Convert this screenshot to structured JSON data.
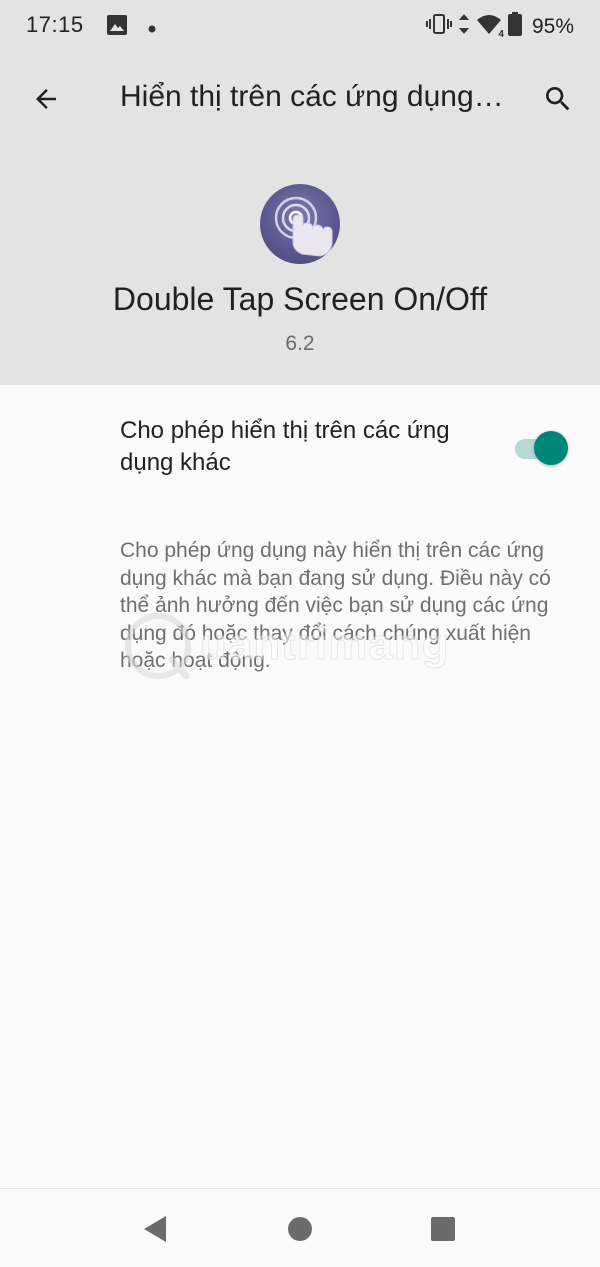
{
  "status_bar": {
    "time": "17:15",
    "left_icons": [
      "image-icon",
      "dot-icon"
    ],
    "right_icons": [
      "vibrate-icon",
      "data-arrows-icon",
      "wifi-icon",
      "battery-icon"
    ],
    "network_badge": "4",
    "battery_percent": "95%"
  },
  "toolbar": {
    "title": "Hiển thị trên các ứng dụng khác",
    "back_icon": "arrow-back-icon",
    "search_icon": "search-icon"
  },
  "app": {
    "name": "Double Tap Screen On/Off",
    "version": "6.2",
    "icon": "double-tap-finger-icon"
  },
  "permission": {
    "label": "Cho phép hiển thị trên các ứng dụng khác",
    "enabled": true
  },
  "description": "Cho phép ứng dụng này hiển thị trên các ứng dụng khác mà bạn đang sử dụng. Điều này có thể ảnh hưởng đến việc bạn sử dụng các ứng dụng đó hoặc thay đổi cách chúng xuất hiện hoặc hoạt động.",
  "watermark": {
    "text": "uantrimang"
  },
  "nav_bar": {
    "buttons": [
      "back-triangle-icon",
      "home-circle-icon",
      "recents-square-icon"
    ]
  },
  "colors": {
    "header_bg": "#e3e3e3",
    "page_bg": "#fafafa",
    "accent": "#00857a",
    "toggle_track": "#b7d8d3"
  }
}
